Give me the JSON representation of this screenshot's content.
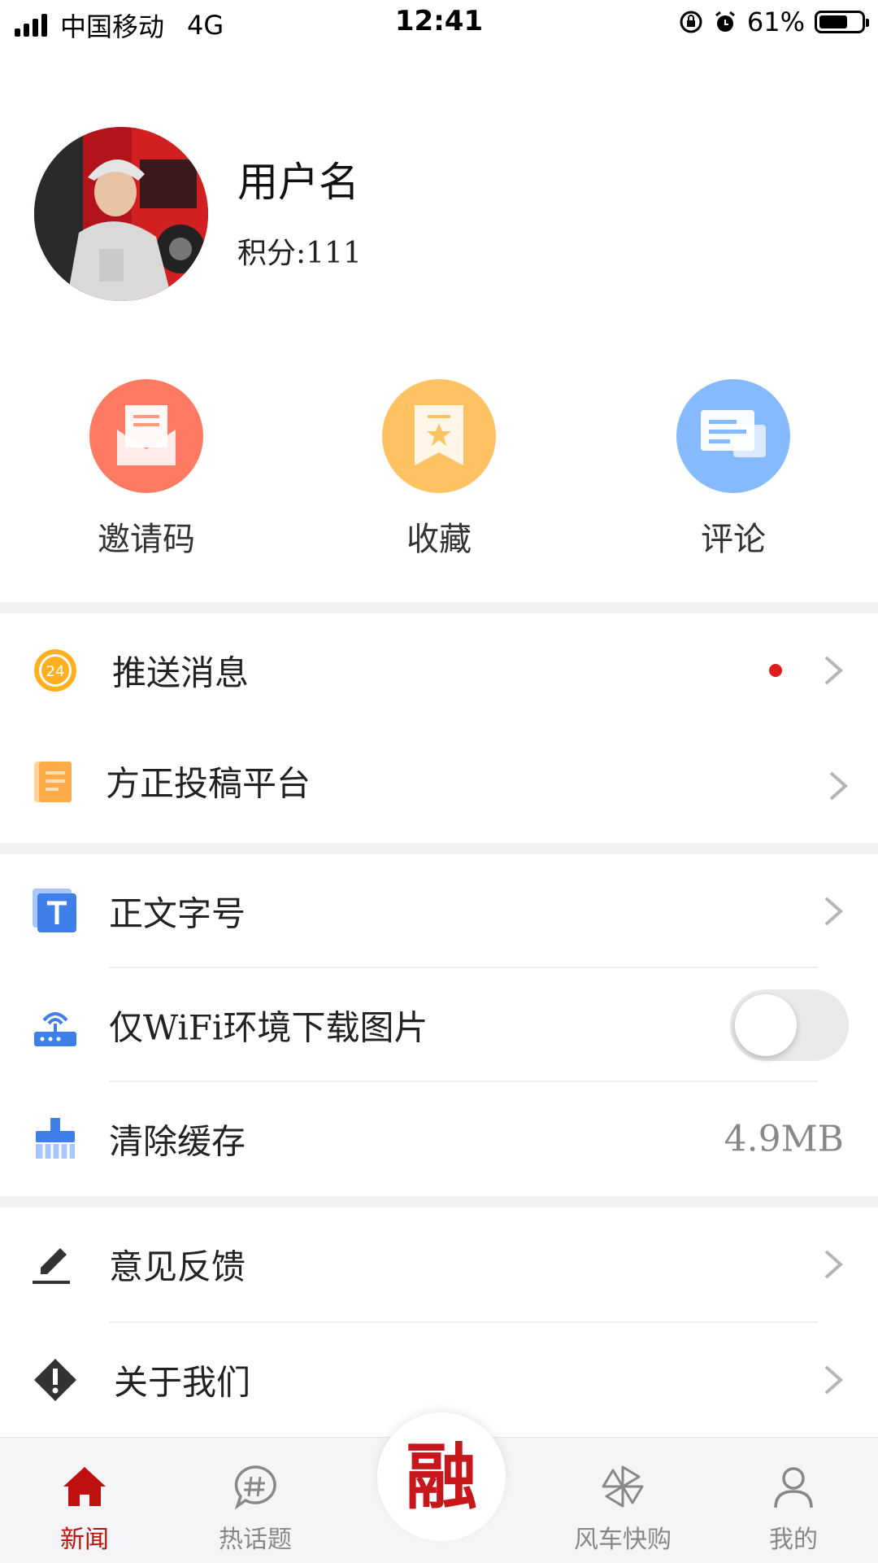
{
  "status_bar": {
    "carrier": "中国移动",
    "network": "4G",
    "time": "12:41",
    "battery": "61%"
  },
  "profile": {
    "username": "用户名",
    "points_label": "积分:",
    "points_value": "111"
  },
  "quick_actions": [
    {
      "label": "邀请码",
      "color": "#ff7a63",
      "icon": "envelope-icon"
    },
    {
      "label": "收藏",
      "color": "#ffc263",
      "icon": "bookmark-star-icon"
    },
    {
      "label": "评论",
      "color": "#86baff",
      "icon": "comment-icon"
    }
  ],
  "menu": {
    "push": {
      "label": "推送消息",
      "icon": "24-hour-icon",
      "has_unread_dot": true
    },
    "submit": {
      "label": "方正投稿平台",
      "icon": "notebook-icon"
    },
    "font": {
      "label": "正文字号",
      "icon": "text-t-icon"
    },
    "wifi": {
      "label": "仅WiFi环境下载图片",
      "icon": "router-icon",
      "enabled": false
    },
    "cache": {
      "label": "清除缓存",
      "icon": "brush-icon",
      "value": "4.9MB"
    },
    "feedback": {
      "label": "意见反馈",
      "icon": "pencil-icon"
    },
    "about": {
      "label": "关于我们",
      "icon": "warning-diamond-icon"
    }
  },
  "tab_bar": {
    "tabs": [
      {
        "label": "新闻",
        "icon": "home-icon",
        "active": true
      },
      {
        "label": "热话题",
        "icon": "hashtag-chat-icon",
        "active": false
      },
      {
        "label": "风车快购",
        "icon": "pinwheel-icon",
        "active": false
      },
      {
        "label": "我的",
        "icon": "user-icon",
        "active": false
      }
    ],
    "center_glyph": "融"
  },
  "colors": {
    "accent": "#c8161d",
    "divider": "#f2f2f2"
  }
}
